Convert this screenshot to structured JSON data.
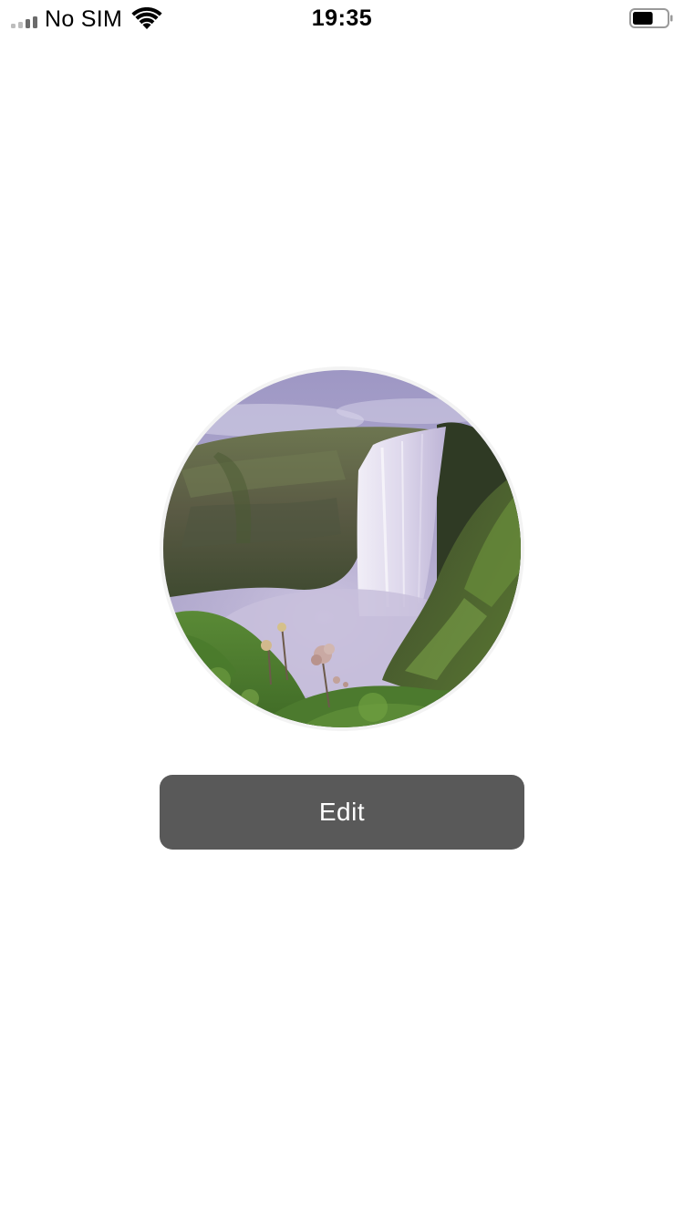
{
  "status_bar": {
    "carrier": "No SIM",
    "time": "19:35",
    "signal_bars_active": 2,
    "signal_bars_total": 4,
    "wifi_icon": "wifi-icon",
    "battery_icon": "battery-icon",
    "battery_level": 0.6
  },
  "profile": {
    "avatar_description_icon": "waterfall-photo",
    "edit_label": "Edit"
  },
  "colors": {
    "button_bg": "#595959",
    "button_text": "#ffffff",
    "background": "#ffffff"
  }
}
